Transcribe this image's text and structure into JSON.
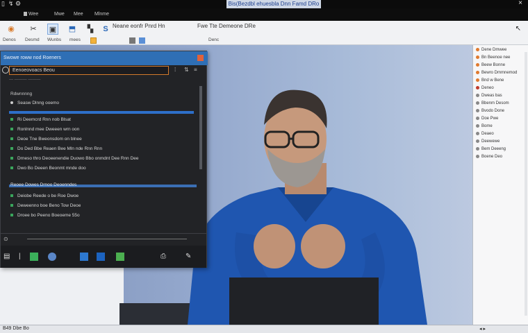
{
  "window": {
    "title": "Bis(Bezdbl ehuesbla Dnn Famd DRo",
    "close_glyph": "×"
  },
  "menu": {
    "items": [
      "Wee",
      "Mwe",
      "Mee",
      "Mlnme"
    ]
  },
  "ribbon": {
    "title_main": "Neane eonfr Pnrd Hn",
    "title_second": "Fwe Tte Demeone DRe",
    "sub_labels": [
      "Denos",
      "Desmd",
      "Wunbs",
      "mees"
    ],
    "sub_after": "Denc"
  },
  "dialog": {
    "title": "Swowe roww nod Roeners",
    "search_value": "Eenoeovoacs Beou",
    "sub_text": "— ——— ———",
    "section": "Rdwnnnng",
    "header_row": "Seasw Dlnng ooemo",
    "rows": [
      "Ri Deemcrd Rnn nob Blsat",
      "Ronlnnd mee Dweeen wrn oon",
      "Deoe Tne Bweonsdom on blnee",
      "Do Ded Bbe Reaen Bee Mln nde Rnn Rnn",
      "Drneso thro Deoeenendie Duowo Bbo onmdnt Dee Rnn Dee",
      "Dwo Bo Deeen Beonmt mnde doo"
    ],
    "highlight_row": "Reoee Dowes Drnoo Deoenndes",
    "rows_lower": [
      "Deiobe Reede o be Roe Dwoe",
      "Deweenno boe Beno Tow Deoe",
      "Droee bo Peeno Boeoeme 55o"
    ]
  },
  "right_panel": {
    "items": [
      {
        "label": "Dene Dmwee",
        "color": "#e07a2e"
      },
      {
        "label": "Bn Beenoe nee",
        "color": "#e07a2e"
      },
      {
        "label": "Beew Bonne",
        "color": "#e07a2e"
      },
      {
        "label": "Bewro Dmmnemod",
        "color": "#e07a2e"
      },
      {
        "label": "Bnd w Bene",
        "color": "#e07a2e"
      },
      {
        "label": "Deneo",
        "color": "#c0392b"
      },
      {
        "label": "Dweas bas",
        "color": "#888888"
      },
      {
        "label": "Bbenm Desom",
        "color": "#888888"
      },
      {
        "label": "Bvodo Done",
        "color": "#888888"
      },
      {
        "label": "Doe Pwe",
        "color": "#888888"
      },
      {
        "label": "Bome",
        "color": "#888888"
      },
      {
        "label": "Deaeo",
        "color": "#888888"
      },
      {
        "label": "Deewewe",
        "color": "#888888"
      },
      {
        "label": "Bem Deeeng",
        "color": "#888888"
      },
      {
        "label": "Boene Deo",
        "color": "#888888"
      }
    ]
  },
  "statusbar": {
    "left": "B49 Dbe Bo",
    "right_glyph": "◂ ▸"
  }
}
